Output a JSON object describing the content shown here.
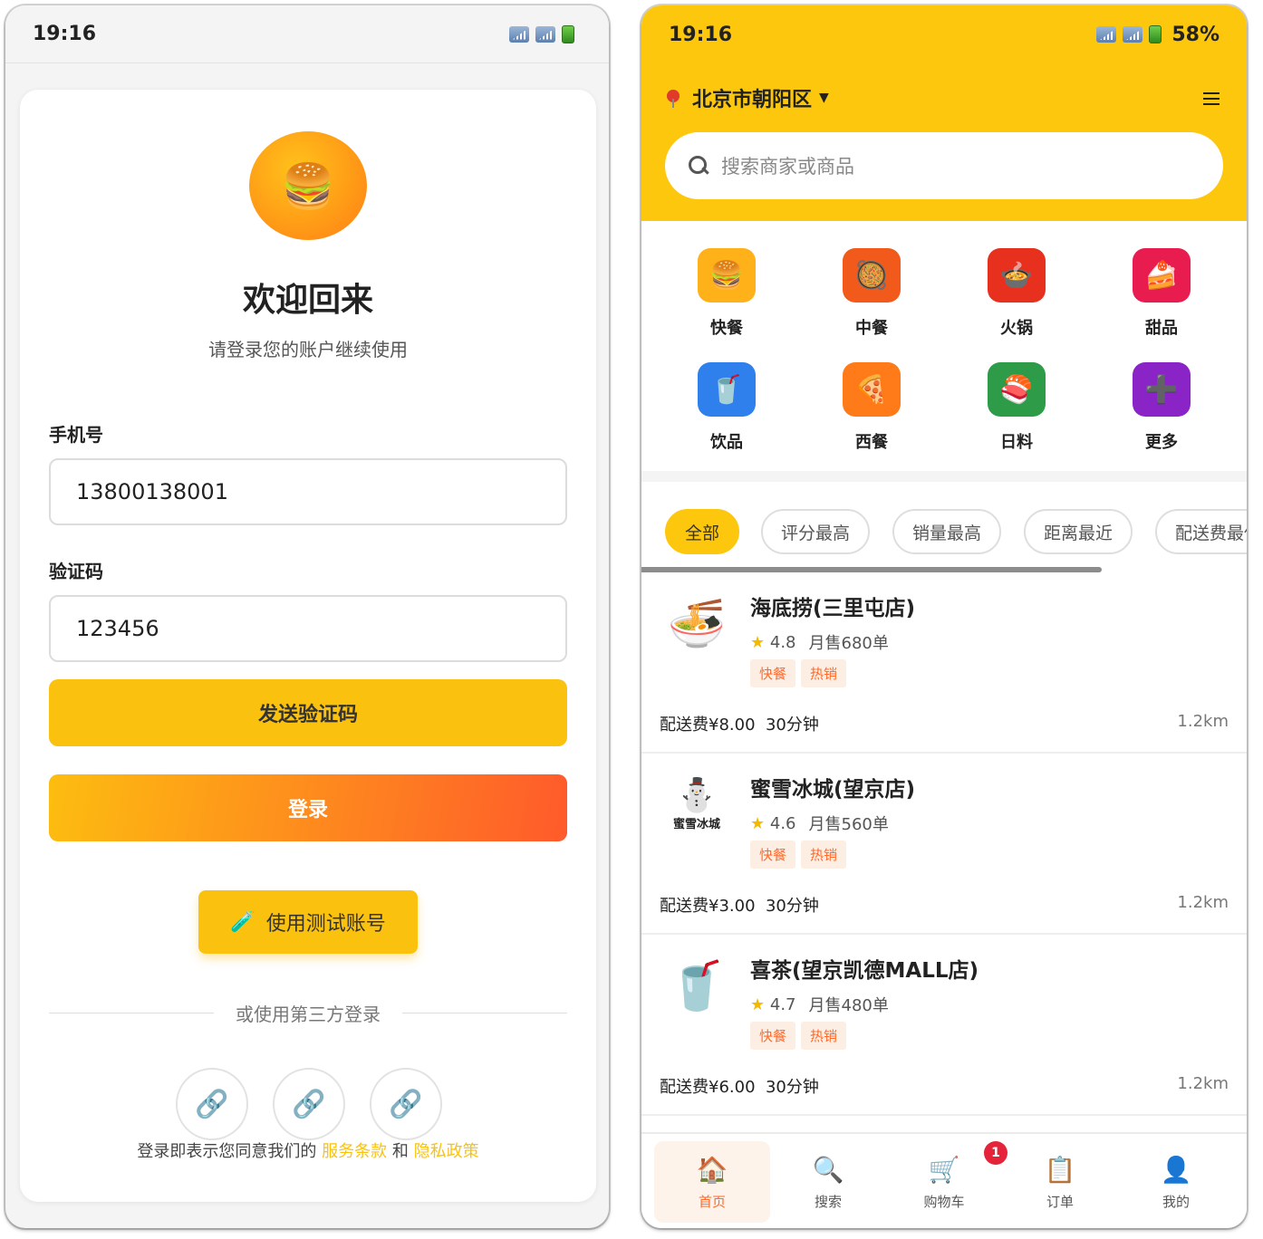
{
  "status_bar": {
    "time": "19:16",
    "battery_pct": "58%"
  },
  "login": {
    "logo_emoji": "🍔",
    "title": "欢迎回来",
    "subtitle": "请登录您的账户继续使用",
    "phone_label": "手机号",
    "phone_value": "13800138001",
    "code_label": "验证码",
    "code_value": "123456",
    "send_code_label": "发送验证码",
    "login_label": "登录",
    "test_account_icon": "🧪",
    "test_account_label": "使用测试账号",
    "third_party_text": "或使用第三方登录",
    "social_icons": [
      "link-icon",
      "link-icon",
      "link-icon"
    ],
    "social_glyph": "🔗",
    "terms_prefix": "登录即表示您同意我们的",
    "terms_link": "服务条款",
    "terms_and": "和",
    "privacy_link": "隐私政策"
  },
  "home": {
    "location": "北京市朝阳区",
    "location_caret": "▼",
    "search_placeholder": "搜索商家或商品",
    "categories": [
      {
        "label": "快餐",
        "emoji": "🍔",
        "color": "#ffb11a"
      },
      {
        "label": "中餐",
        "emoji": "🥘",
        "color": "#f25a1c"
      },
      {
        "label": "火锅",
        "emoji": "🍲",
        "color": "#e8301f"
      },
      {
        "label": "甜品",
        "emoji": "🍰",
        "color": "#e81c4f"
      },
      {
        "label": "饮品",
        "emoji": "🥤",
        "color": "#2f80ec"
      },
      {
        "label": "西餐",
        "emoji": "🍕",
        "color": "#ff7b1a"
      },
      {
        "label": "日料",
        "emoji": "🍣",
        "color": "#2e9b48"
      },
      {
        "label": "更多",
        "emoji": "➕",
        "color": "#8a24c6"
      }
    ],
    "filters": [
      "全部",
      "评分最高",
      "销量最高",
      "距离最近",
      "配送费最低"
    ],
    "shops": [
      {
        "name": "海底捞(三里屯店)",
        "rating": "4.8",
        "sales": "月售680单",
        "tags": [
          "快餐",
          "热销"
        ],
        "fee": "配送费¥8.00",
        "time": "30分钟",
        "distance": "1.2km",
        "logo": "🍜"
      },
      {
        "name": "蜜雪冰城(望京店)",
        "rating": "4.6",
        "sales": "月售560单",
        "tags": [
          "快餐",
          "热销"
        ],
        "fee": "配送费¥3.00",
        "time": "30分钟",
        "distance": "1.2km",
        "logo": "⛄",
        "logo_text": "蜜雪冰城"
      },
      {
        "name": "喜茶(望京凯德MALL店)",
        "rating": "4.7",
        "sales": "月售480单",
        "tags": [
          "快餐",
          "热销"
        ],
        "fee": "配送费¥6.00",
        "time": "30分钟",
        "distance": "1.2km",
        "logo": "🥤"
      }
    ],
    "tabs": [
      {
        "label": "首页",
        "emoji": "🏠"
      },
      {
        "label": "搜索",
        "emoji": "🔍"
      },
      {
        "label": "购物车",
        "emoji": "🛒"
      },
      {
        "label": "订单",
        "emoji": "📋"
      },
      {
        "label": "我的",
        "emoji": "👤"
      }
    ],
    "cart_badge": "1"
  }
}
